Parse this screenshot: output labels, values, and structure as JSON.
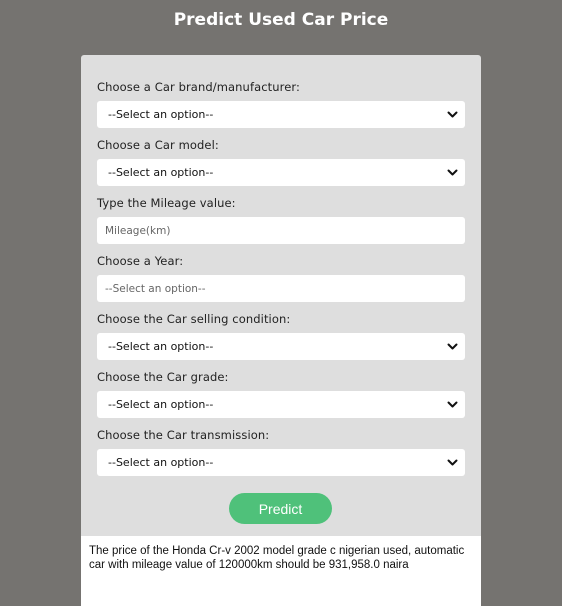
{
  "app": {
    "title": "Predict Used Car Price"
  },
  "form": {
    "brand_label": "Choose a Car brand/manufacturer:",
    "brand_value": "--Select an option--",
    "model_label": "Choose a Car model:",
    "model_value": "--Select an option--",
    "mileage_label": "Type the Mileage value:",
    "mileage_placeholder": "Mileage(km)",
    "year_label": "Choose a Year:",
    "year_placeholder": "--Select an option--",
    "condition_label": "Choose the Car selling condition:",
    "condition_value": "--Select an option--",
    "grade_label": "Choose the Car grade:",
    "grade_value": "--Select an option--",
    "transmission_label": "Choose the Car transmission:",
    "transmission_value": "--Select an option--",
    "predict_label": "Predict"
  },
  "result": {
    "text": "The price of the Honda Cr-v 2002 model grade c nigerian used, automatic car with mileage value of 120000km should be 931,958.0 naira"
  },
  "icons": {
    "dropdown": "chevron-down-icon"
  },
  "colors": {
    "background": "#757370",
    "card": "#dedede",
    "button": "#4fc17a"
  }
}
